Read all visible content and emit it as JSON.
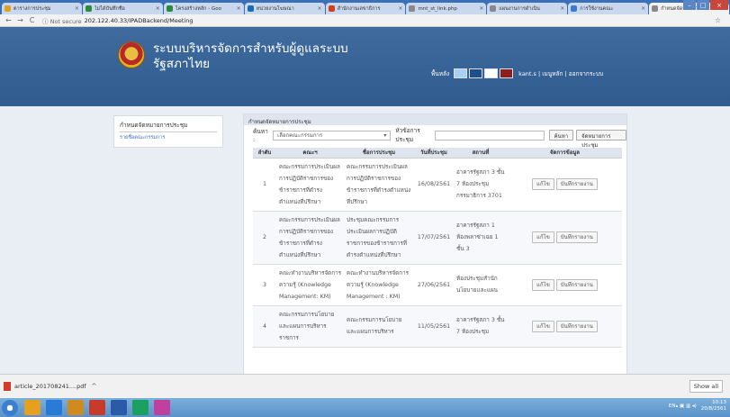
{
  "browser": {
    "tabs": [
      {
        "title": "ตารางการประชุม",
        "color": "#e0a020"
      },
      {
        "title": "ไม่ได้บันทึกชื่อ",
        "color": "#2a8a3a"
      },
      {
        "title": "โครงสร้างหลัก - Goo",
        "color": "#2a8a3a"
      },
      {
        "title": "หน่วยงานโฆษณา",
        "color": "#1a6ab0"
      },
      {
        "title": "สำนักงานเลขาธิการ",
        "color": "#d04020"
      },
      {
        "title": "mnt_st_link.php",
        "color": "#888888"
      },
      {
        "title": "แผนงานการดำเนิน",
        "color": "#888888"
      },
      {
        "title": "การใช้งานคณะ",
        "color": "#3a7ad0"
      },
      {
        "title": "กำหนดจัดหมายการ",
        "color": "#888888"
      }
    ],
    "nav": {
      "back": "←",
      "forward": "→",
      "reload": "C"
    },
    "security_label": "Not secure",
    "url": "202.122.40.33/IPADBackend/Meeting"
  },
  "header": {
    "title_line1": "ระบบบริหารจัดการสำหรับผู้ดูแลระบบ",
    "title_line2": "รัฐสภาไทย",
    "bg_label": "พื้นหลัง",
    "user_links": "kant.s | เมนูหลัก | ออกจากระบบ",
    "swatches": [
      "#a8d0f0",
      "#1f4e8c",
      "#ffffff",
      "#8b1f1f"
    ]
  },
  "sidebar": {
    "title": "กำหนดจัดหมายการประชุม",
    "link": "รายชื่อคณะกรรมการ"
  },
  "panel": {
    "heading": "กำหนดจัดหมายการประชุม",
    "search_label": "ค้นหา :",
    "select_value": "เลือกคณะกรรมการ",
    "topic_label": "หัวข้อการประชุม",
    "search_button": "ค้นหา",
    "add_button": "จัดหมายการประชุม",
    "columns": [
      "ลำดับ",
      "คณะฯ",
      "ชื่อการประชุม",
      "วันที่ประชุม",
      "สถานที่",
      "จัดการข้อมูล"
    ],
    "edit_label": "แก้ไข",
    "record_label": "บันทึกรายงาน",
    "rows": [
      {
        "no": "1",
        "committee": "คณะกรรมการประเมินผลการปฏิบัติราชการของข้าราชการที่ดำรงตำแหน่งที่ปรึกษา",
        "meeting": "คณะกรรมการประเมินผลการปฏิบัติราชการของข้าราชการที่ดำรงตำแหน่งที่ปรึกษา",
        "date": "16/08/2561",
        "place": "อาคารรัฐสภา 3 ชั้น 7 ห้องประชุมกรรมาธิการ 3701"
      },
      {
        "no": "2",
        "committee": "คณะกรรมการประเมินผลการปฏิบัติราชการของข้าราชการที่ดำรงตำแหน่งที่ปรึกษา",
        "meeting": "ประชุมคณะกรรมการประเมินผลการปฏิบัติราชการของข้าราชการที่ดำรงตำแหน่งที่ปรึกษา",
        "date": "17/07/2561",
        "place": "อาคารรัฐสภา 1 ห้องพลาซ่าเฉย 1 ชั้น 3"
      },
      {
        "no": "3",
        "committee": "คณะทำงานบริหารจัดการความรู้ (Knowledge Management: KM)",
        "meeting": "คณะทำงานบริหารจัดการความรู้ (Knowledge Management : KM)",
        "date": "27/06/2561",
        "place": "ห้องประชุมสำนักนโยบายและแผน"
      },
      {
        "no": "4",
        "committee": "คณะกรรมการนโยบายและแผนการบริหารราชการ",
        "meeting": "คณะกรรมการนโยบายและแผนการบริหาร",
        "date": "11/05/2561",
        "place": "อาคารรัฐสภา 3 ชั้น 7 ห้องประชุม"
      }
    ]
  },
  "downloads": {
    "file_name": "article_201708241....pdf",
    "caret": "^",
    "show_all": "Show all"
  },
  "taskbar": {
    "lang": "EN",
    "time": "10:13",
    "date": "20/8/2561",
    "apps": [
      "#e6a020",
      "#2a7ad8",
      "#d08a20",
      "#c83a2a",
      "#2a5aa8",
      "#1aa060",
      "#c040a0"
    ]
  }
}
